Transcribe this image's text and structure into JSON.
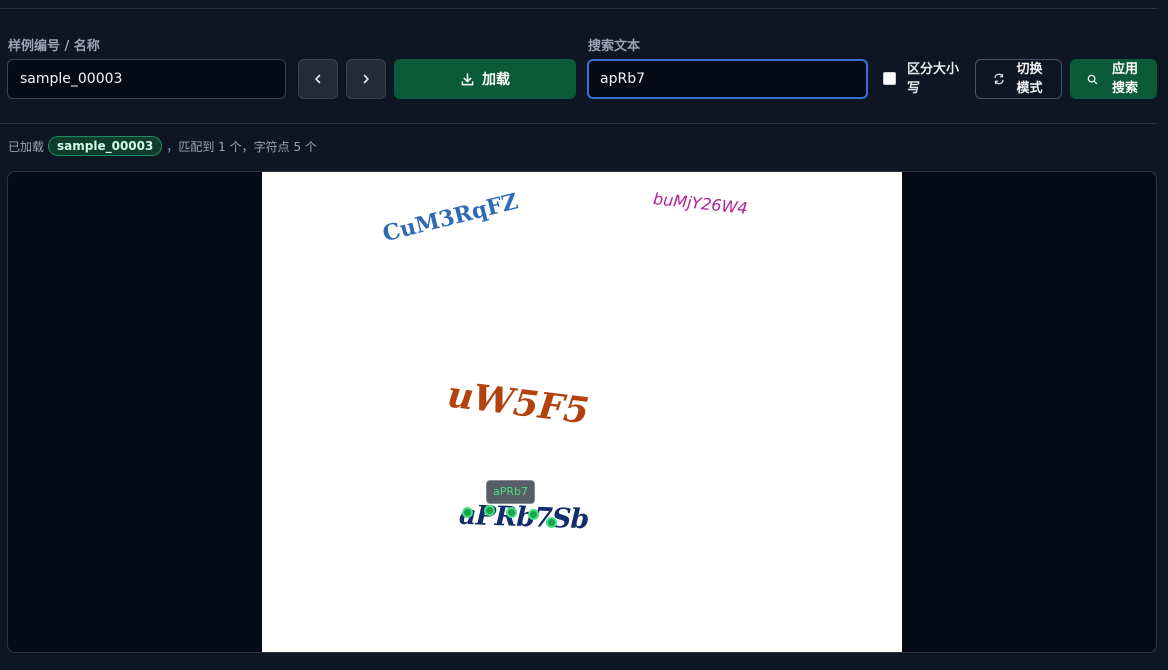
{
  "sample": {
    "label": "样例编号 / 名称",
    "value": "sample_00003",
    "prev_icon": "chevron-left-icon",
    "next_icon": "chevron-right-icon",
    "load_label": "加载",
    "load_icon": "download-icon"
  },
  "search": {
    "label": "搜索文本",
    "value": "apRb7",
    "case_label": "区分大小写",
    "case_checked": false,
    "toggle_label": "切换模式",
    "toggle_icon": "swap-icon",
    "apply_label": "应用搜索",
    "apply_icon": "search-icon"
  },
  "status": {
    "prefix": "已加载",
    "sample": "sample_00003",
    "suffix": "，匹配到 1 个，字符点 5 个"
  },
  "canvas": {
    "words": [
      "CuM3RqFZ",
      "buMjY26W4",
      "uW5F5",
      "aPRb7Sb"
    ],
    "match_tooltip": "aPRb7"
  },
  "colors": {
    "accent_green": "#0b5a3a",
    "focus_blue": "#3b6fd8",
    "match_dot": "#16a34a"
  }
}
